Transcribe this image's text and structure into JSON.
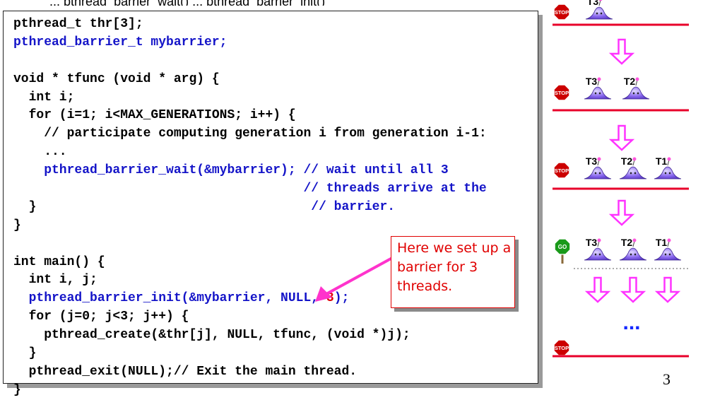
{
  "header_partial": "... pthread_barrier_wait() ... pthread_barrier_init()",
  "code": {
    "lines": [
      [
        {
          "t": "pthread_t thr[3];"
        }
      ],
      [
        {
          "t": "pthread_barrier_t mybarrier;",
          "c": "hl"
        }
      ],
      [
        {
          "t": ""
        }
      ],
      [
        {
          "t": "void * tfunc (void * arg) {"
        }
      ],
      [
        {
          "t": "  int i;"
        }
      ],
      [
        {
          "t": "  for (i=1; i<MAX_GENERATIONS; i++) {"
        }
      ],
      [
        {
          "t": "    // participate computing generation i from generation i-1:"
        }
      ],
      [
        {
          "t": "    ..."
        }
      ],
      [
        {
          "t": "    pthread_barrier_wait(&mybarrier); // wait until all 3",
          "c": "hl"
        }
      ],
      [
        {
          "t": "                                      // threads arrive at the",
          "c": "hl"
        }
      ],
      [
        {
          "t": "  }"
        },
        {
          "t": "                                    // barrier.",
          "c": "hl"
        }
      ],
      [
        {
          "t": "}"
        }
      ],
      [
        {
          "t": ""
        }
      ],
      [
        {
          "t": "int main() {"
        }
      ],
      [
        {
          "t": "  int i, j;"
        }
      ],
      [
        {
          "t": "  pthread_barrier_init(&mybarrier, NULL, ",
          "c": "hl"
        },
        {
          "t": "3",
          "c": "red"
        },
        {
          "t": ");",
          "c": "hl"
        }
      ],
      [
        {
          "t": "  for (j=0; j<3; j++) {"
        }
      ],
      [
        {
          "t": "    pthread_create(&thr[j], NULL, tfunc, (void *)j);"
        }
      ],
      [
        {
          "t": "  }"
        }
      ],
      [
        {
          "t": "  pthread_exit(NULL);// Exit the main thread."
        }
      ],
      [
        {
          "t": "}"
        }
      ]
    ]
  },
  "callout": {
    "lines": [
      "Here we set up a",
      "barrier for 3",
      "threads."
    ]
  },
  "diagram": {
    "stop_label": "STOP",
    "go_label": "GO",
    "threads": [
      "T1",
      "T2",
      "T3"
    ],
    "ellipsis": "...",
    "colors": {
      "barrier": "#e8002a",
      "arrow": "#ff33ff",
      "stop": "#cc0000",
      "go": "#1a9a1a",
      "cap": "#7755dd"
    }
  },
  "page_number": "3"
}
